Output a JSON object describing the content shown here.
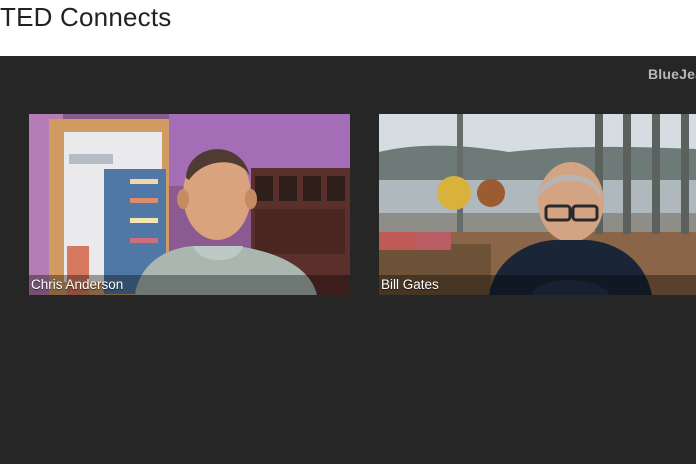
{
  "page": {
    "title": "TED Connects"
  },
  "app": {
    "brand": "BlueJeans"
  },
  "participants": [
    {
      "name": "Chris Anderson",
      "avatar_icon": "person-video-icon"
    },
    {
      "name": "Bill Gates",
      "avatar_icon": "person-video-icon"
    }
  ],
  "colors": {
    "stage_background": "#262626",
    "title_text": "#222222",
    "brand_text": "#b9b9b9",
    "name_text": "#ffffff"
  }
}
